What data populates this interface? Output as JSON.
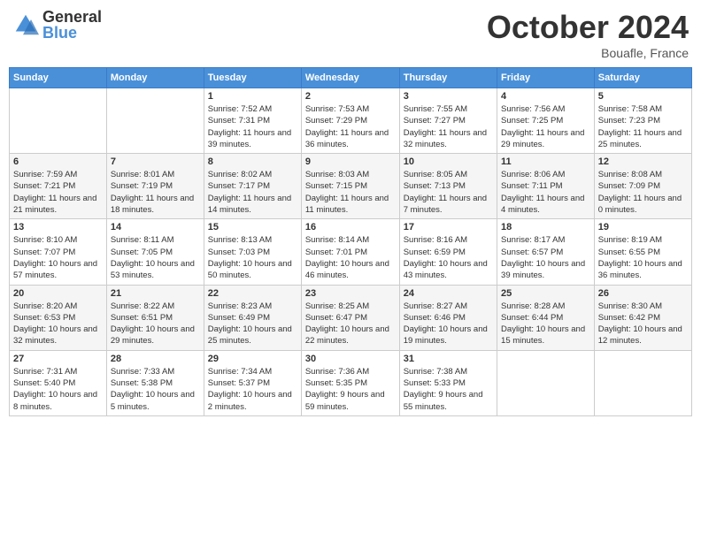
{
  "header": {
    "logo_general": "General",
    "logo_blue": "Blue",
    "month_title": "October 2024",
    "location": "Bouafle, France"
  },
  "days_of_week": [
    "Sunday",
    "Monday",
    "Tuesday",
    "Wednesday",
    "Thursday",
    "Friday",
    "Saturday"
  ],
  "weeks": [
    [
      {
        "day": "",
        "info": ""
      },
      {
        "day": "",
        "info": ""
      },
      {
        "day": "1",
        "info": "Sunrise: 7:52 AM\nSunset: 7:31 PM\nDaylight: 11 hours and 39 minutes."
      },
      {
        "day": "2",
        "info": "Sunrise: 7:53 AM\nSunset: 7:29 PM\nDaylight: 11 hours and 36 minutes."
      },
      {
        "day": "3",
        "info": "Sunrise: 7:55 AM\nSunset: 7:27 PM\nDaylight: 11 hours and 32 minutes."
      },
      {
        "day": "4",
        "info": "Sunrise: 7:56 AM\nSunset: 7:25 PM\nDaylight: 11 hours and 29 minutes."
      },
      {
        "day": "5",
        "info": "Sunrise: 7:58 AM\nSunset: 7:23 PM\nDaylight: 11 hours and 25 minutes."
      }
    ],
    [
      {
        "day": "6",
        "info": "Sunrise: 7:59 AM\nSunset: 7:21 PM\nDaylight: 11 hours and 21 minutes."
      },
      {
        "day": "7",
        "info": "Sunrise: 8:01 AM\nSunset: 7:19 PM\nDaylight: 11 hours and 18 minutes."
      },
      {
        "day": "8",
        "info": "Sunrise: 8:02 AM\nSunset: 7:17 PM\nDaylight: 11 hours and 14 minutes."
      },
      {
        "day": "9",
        "info": "Sunrise: 8:03 AM\nSunset: 7:15 PM\nDaylight: 11 hours and 11 minutes."
      },
      {
        "day": "10",
        "info": "Sunrise: 8:05 AM\nSunset: 7:13 PM\nDaylight: 11 hours and 7 minutes."
      },
      {
        "day": "11",
        "info": "Sunrise: 8:06 AM\nSunset: 7:11 PM\nDaylight: 11 hours and 4 minutes."
      },
      {
        "day": "12",
        "info": "Sunrise: 8:08 AM\nSunset: 7:09 PM\nDaylight: 11 hours and 0 minutes."
      }
    ],
    [
      {
        "day": "13",
        "info": "Sunrise: 8:10 AM\nSunset: 7:07 PM\nDaylight: 10 hours and 57 minutes."
      },
      {
        "day": "14",
        "info": "Sunrise: 8:11 AM\nSunset: 7:05 PM\nDaylight: 10 hours and 53 minutes."
      },
      {
        "day": "15",
        "info": "Sunrise: 8:13 AM\nSunset: 7:03 PM\nDaylight: 10 hours and 50 minutes."
      },
      {
        "day": "16",
        "info": "Sunrise: 8:14 AM\nSunset: 7:01 PM\nDaylight: 10 hours and 46 minutes."
      },
      {
        "day": "17",
        "info": "Sunrise: 8:16 AM\nSunset: 6:59 PM\nDaylight: 10 hours and 43 minutes."
      },
      {
        "day": "18",
        "info": "Sunrise: 8:17 AM\nSunset: 6:57 PM\nDaylight: 10 hours and 39 minutes."
      },
      {
        "day": "19",
        "info": "Sunrise: 8:19 AM\nSunset: 6:55 PM\nDaylight: 10 hours and 36 minutes."
      }
    ],
    [
      {
        "day": "20",
        "info": "Sunrise: 8:20 AM\nSunset: 6:53 PM\nDaylight: 10 hours and 32 minutes."
      },
      {
        "day": "21",
        "info": "Sunrise: 8:22 AM\nSunset: 6:51 PM\nDaylight: 10 hours and 29 minutes."
      },
      {
        "day": "22",
        "info": "Sunrise: 8:23 AM\nSunset: 6:49 PM\nDaylight: 10 hours and 25 minutes."
      },
      {
        "day": "23",
        "info": "Sunrise: 8:25 AM\nSunset: 6:47 PM\nDaylight: 10 hours and 22 minutes."
      },
      {
        "day": "24",
        "info": "Sunrise: 8:27 AM\nSunset: 6:46 PM\nDaylight: 10 hours and 19 minutes."
      },
      {
        "day": "25",
        "info": "Sunrise: 8:28 AM\nSunset: 6:44 PM\nDaylight: 10 hours and 15 minutes."
      },
      {
        "day": "26",
        "info": "Sunrise: 8:30 AM\nSunset: 6:42 PM\nDaylight: 10 hours and 12 minutes."
      }
    ],
    [
      {
        "day": "27",
        "info": "Sunrise: 7:31 AM\nSunset: 5:40 PM\nDaylight: 10 hours and 8 minutes."
      },
      {
        "day": "28",
        "info": "Sunrise: 7:33 AM\nSunset: 5:38 PM\nDaylight: 10 hours and 5 minutes."
      },
      {
        "day": "29",
        "info": "Sunrise: 7:34 AM\nSunset: 5:37 PM\nDaylight: 10 hours and 2 minutes."
      },
      {
        "day": "30",
        "info": "Sunrise: 7:36 AM\nSunset: 5:35 PM\nDaylight: 9 hours and 59 minutes."
      },
      {
        "day": "31",
        "info": "Sunrise: 7:38 AM\nSunset: 5:33 PM\nDaylight: 9 hours and 55 minutes."
      },
      {
        "day": "",
        "info": ""
      },
      {
        "day": "",
        "info": ""
      }
    ]
  ]
}
